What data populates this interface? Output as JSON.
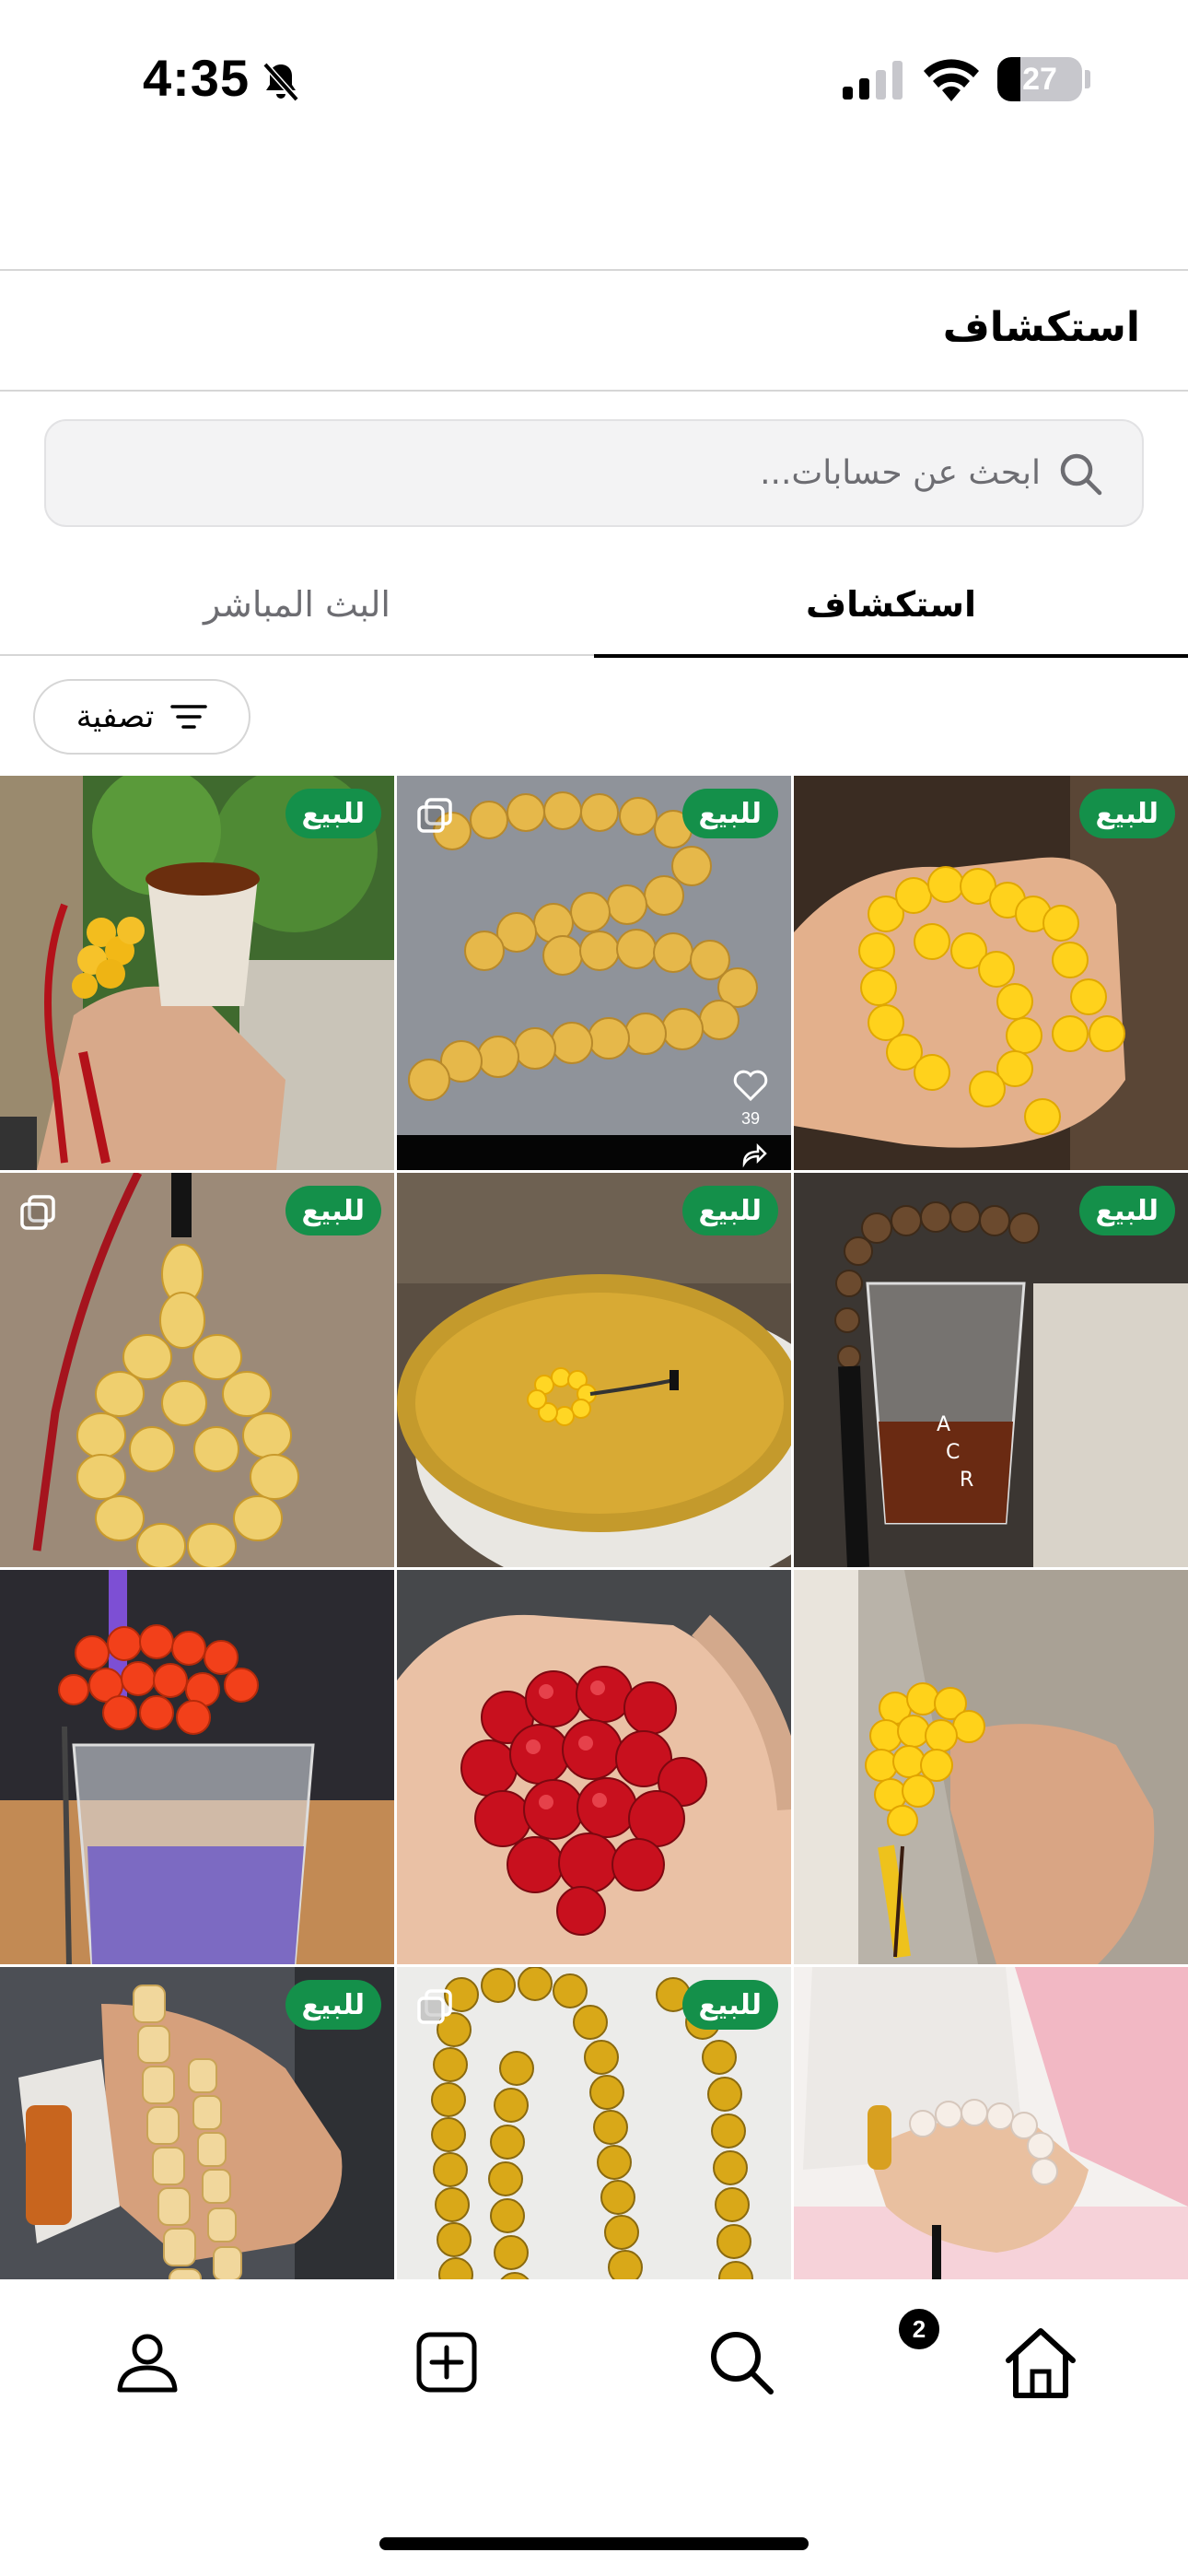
{
  "status_bar": {
    "time": "4:35",
    "battery": "27",
    "battery_level_percent": 27,
    "icons": [
      "bell-slash-icon",
      "cellular-signal-icon",
      "wifi-icon",
      "battery-icon"
    ]
  },
  "header": {
    "title": "استكشاف"
  },
  "search": {
    "placeholder": "ابحث عن حسابات..."
  },
  "tabs": [
    {
      "label": "استكشاف",
      "active": true
    },
    {
      "label": "البث المباشر",
      "active": false
    }
  ],
  "filter": {
    "label": "تصفية",
    "icon": "filter-lines-icon"
  },
  "grid": {
    "items": [
      {
        "badge": "للبيع",
        "multi": false,
        "description": "yellow prayer beads with iced drink"
      },
      {
        "badge": "للبيع",
        "multi": true,
        "likes": "39",
        "description": "amber bead strand on grey"
      },
      {
        "badge": "للبيع",
        "multi": false,
        "description": "yellow amber beads in palm"
      },
      {
        "badge": "للبيع",
        "multi": true,
        "description": "faceted butter amber beads with red tassel"
      },
      {
        "badge": "للبيع",
        "multi": false,
        "description": "small amber beads on gold plate"
      },
      {
        "badge": "للبيع",
        "multi": false,
        "description": "dark beads over iced coffee cup"
      },
      {
        "badge": "",
        "multi": false,
        "description": "red beads on purple drink"
      },
      {
        "badge": "",
        "multi": false,
        "description": "red amber beads in hand"
      },
      {
        "badge": "",
        "multi": false,
        "description": "yellow beads held by hand"
      },
      {
        "badge": "للبيع",
        "multi": false,
        "description": "barrel beads in hand with watch"
      },
      {
        "badge": "للبيع",
        "multi": true,
        "description": "clear amber strands"
      },
      {
        "badge": "",
        "multi": false,
        "description": "child holding white beads"
      }
    ]
  },
  "bottom_nav": {
    "items": [
      "profile-icon",
      "add-post-icon",
      "search-icon",
      "home-icon"
    ],
    "notification_count": "2"
  },
  "colors": {
    "badge_green": "#14904a",
    "divider": "#d6d6d6",
    "search_bg": "#f3f3f4",
    "muted_text": "#6d6d72"
  }
}
